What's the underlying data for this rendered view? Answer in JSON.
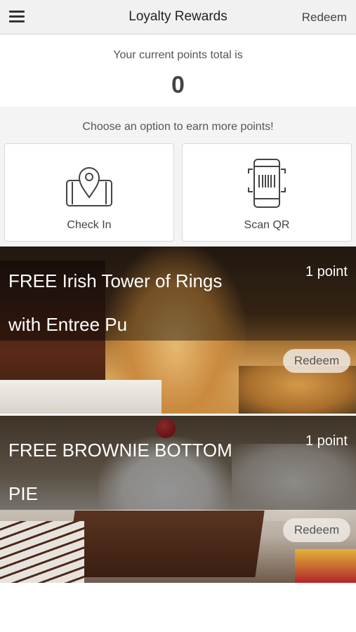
{
  "header": {
    "menu_icon": "hamburger-menu-icon",
    "title": "Loyalty Rewards",
    "redeem_label": "Redeem"
  },
  "points": {
    "label": "Your current points total is",
    "value": "0"
  },
  "earn": {
    "label": "Choose an option to earn more points!",
    "options": [
      {
        "label": "Check In",
        "icon": "phone-location-pin-icon"
      },
      {
        "label": "Scan QR",
        "icon": "phone-barcode-scan-icon"
      }
    ]
  },
  "rewards": [
    {
      "title": "FREE Irish Tower of Rings with Entree Pu",
      "points": "1 point",
      "redeem_label": "Redeem"
    },
    {
      "title": "FREE BROWNIE BOTTOM PIE",
      "points": "1 point",
      "redeem_label": "Redeem"
    }
  ]
}
